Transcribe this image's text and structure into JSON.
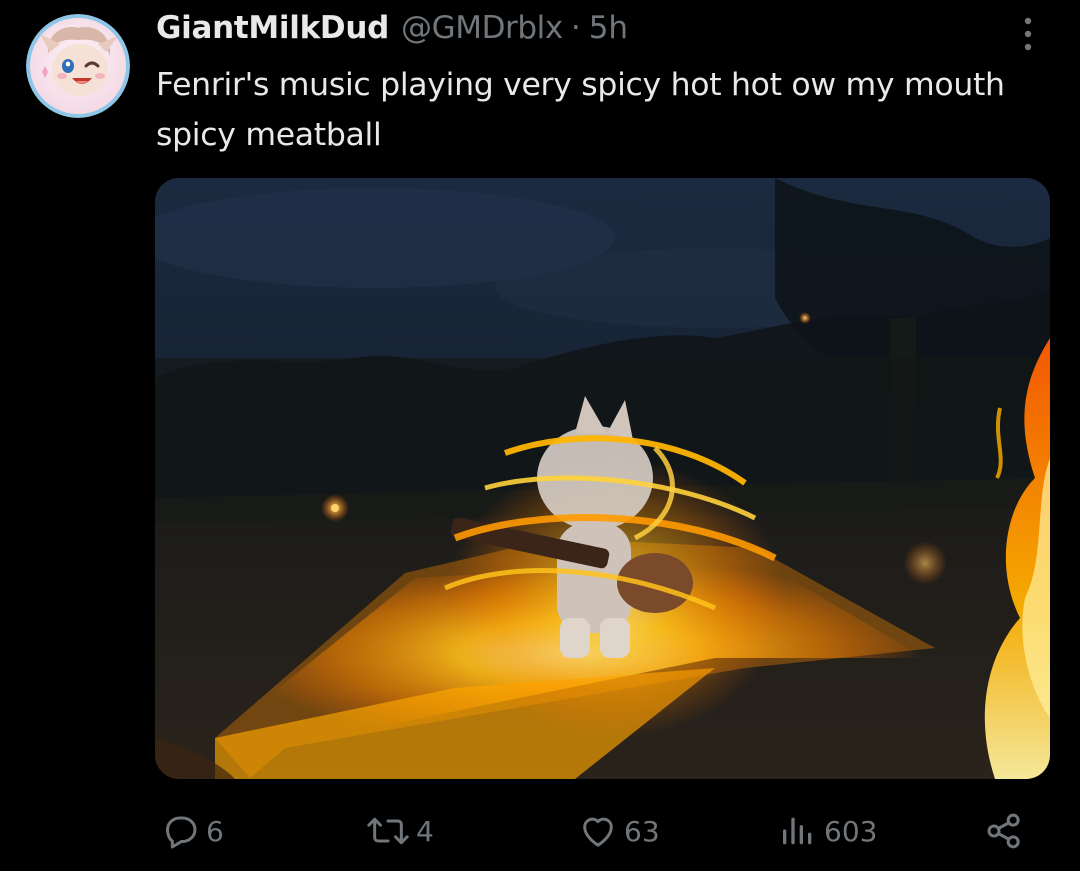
{
  "tweet": {
    "author": {
      "display_name": "GiantMilkDud",
      "handle": "@GMDrblx",
      "separator": "·",
      "timestamp": "5h",
      "avatar_icon": "avatar-cartoon-character"
    },
    "text": "Fenrir's music playing very spicy hot hot ow my mouth spicy meatball",
    "media": {
      "kind": "game-screenshot",
      "description_icon": "fire-effect"
    },
    "actions": {
      "reply": {
        "icon": "reply-icon",
        "count": "6"
      },
      "retweet": {
        "icon": "retweet-icon",
        "count": "4"
      },
      "like": {
        "icon": "heart-icon",
        "count": "63"
      },
      "views": {
        "icon": "views-icon",
        "count": "603"
      },
      "share": {
        "icon": "share-icon"
      }
    }
  },
  "colors": {
    "background": "#000000",
    "text_primary": "#e7e9ea",
    "text_secondary": "#71767b"
  }
}
